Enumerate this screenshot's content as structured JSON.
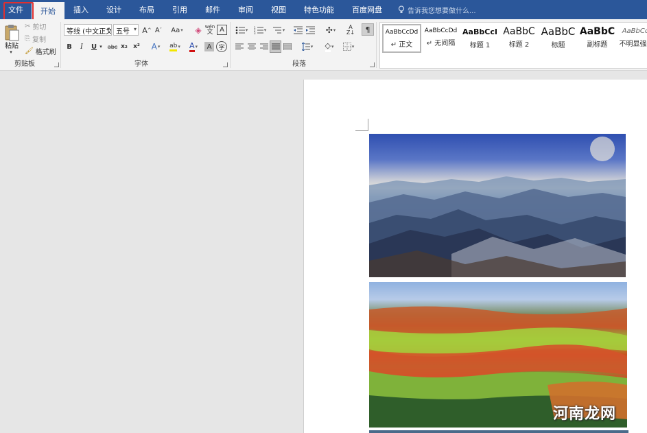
{
  "menu": {
    "file": "文件",
    "tabs": [
      "开始",
      "插入",
      "设计",
      "布局",
      "引用",
      "邮件",
      "审阅",
      "视图",
      "特色功能",
      "百度网盘"
    ],
    "tell_me": "告诉我您想要做什么..."
  },
  "clipboard": {
    "paste": "粘贴",
    "cut": "剪切",
    "copy": "复制",
    "format_painter": "格式刷",
    "group_label": "剪贴板"
  },
  "font": {
    "font_name": "等线 (中文正文)",
    "font_size": "五号",
    "bold": "B",
    "italic": "I",
    "underline": "U",
    "strike": "abc",
    "subscript": "x₂",
    "superscript": "x²",
    "case": "Aa",
    "phonetic": "wén",
    "border_char": "A",
    "group_label": "字体"
  },
  "paragraph": {
    "group_label": "段落"
  },
  "styles": [
    {
      "sample": "AaBbCcDd",
      "name": "↵ 正文",
      "selected": true
    },
    {
      "sample": "AaBbCcDd",
      "name": "↵ 无间隔",
      "selected": false
    },
    {
      "sample": "AaBbCcI",
      "name": "标题 1",
      "selected": false
    },
    {
      "sample": "AaBbC",
      "name": "标题 2",
      "selected": false
    },
    {
      "sample": "AaBbC",
      "name": "标题",
      "selected": false
    },
    {
      "sample": "AaBbC",
      "name": "副标题",
      "selected": false
    },
    {
      "sample": "AaBbCcI",
      "name": "不明显强调",
      "selected": false
    }
  ],
  "watermark": "河南龙网",
  "colors": {
    "menubar": "#2b579a",
    "ribbon": "#f3f3f3",
    "highlight": "#e03030"
  }
}
